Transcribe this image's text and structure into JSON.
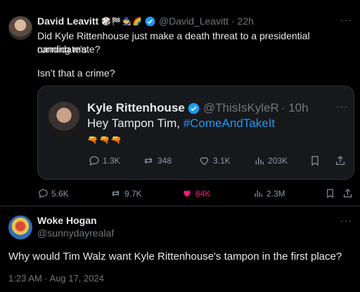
{
  "tweet": {
    "author_name": "David Leavitt",
    "author_emoji": "🎲🏁🧙🌈",
    "author_handle": "@David_Leavitt",
    "time": "· 22h",
    "line1": "Did Kyle Rittenhouse just make a death threat to a presidential candidate’s",
    "line2": "running mate?",
    "line3": "Isn’t that a crime?",
    "stats": {
      "replies": "5.6K",
      "reposts": "9.7K",
      "likes": "84K",
      "views": "2.3M"
    }
  },
  "quoted": {
    "author_name": "Kyle Rittenhouse",
    "author_handle": "@ThisIsKyleR",
    "time": "· 10h",
    "text": "Hey Tampon Tim, ",
    "hashtag": "#ComeAndTakeIt",
    "emoji": "🔫🔫🔫",
    "stats": {
      "replies": "1.3K",
      "reposts": "348",
      "likes": "3.1K",
      "views": "203K"
    }
  },
  "reply": {
    "author_name": "Woke Hogan",
    "author_handle": "@sunnydayrealaf",
    "text": "Why would Tim Walz want Kyle Rittenhouse's tampon in the first place?",
    "timestamp": "1:23 AM · Aug 17, 2024"
  },
  "more_label": "···",
  "colors": {
    "bg": "#000000",
    "text": "#e7e9ea",
    "muted": "#71767b",
    "accent": "#1d9bf0",
    "like": "#f91880"
  }
}
